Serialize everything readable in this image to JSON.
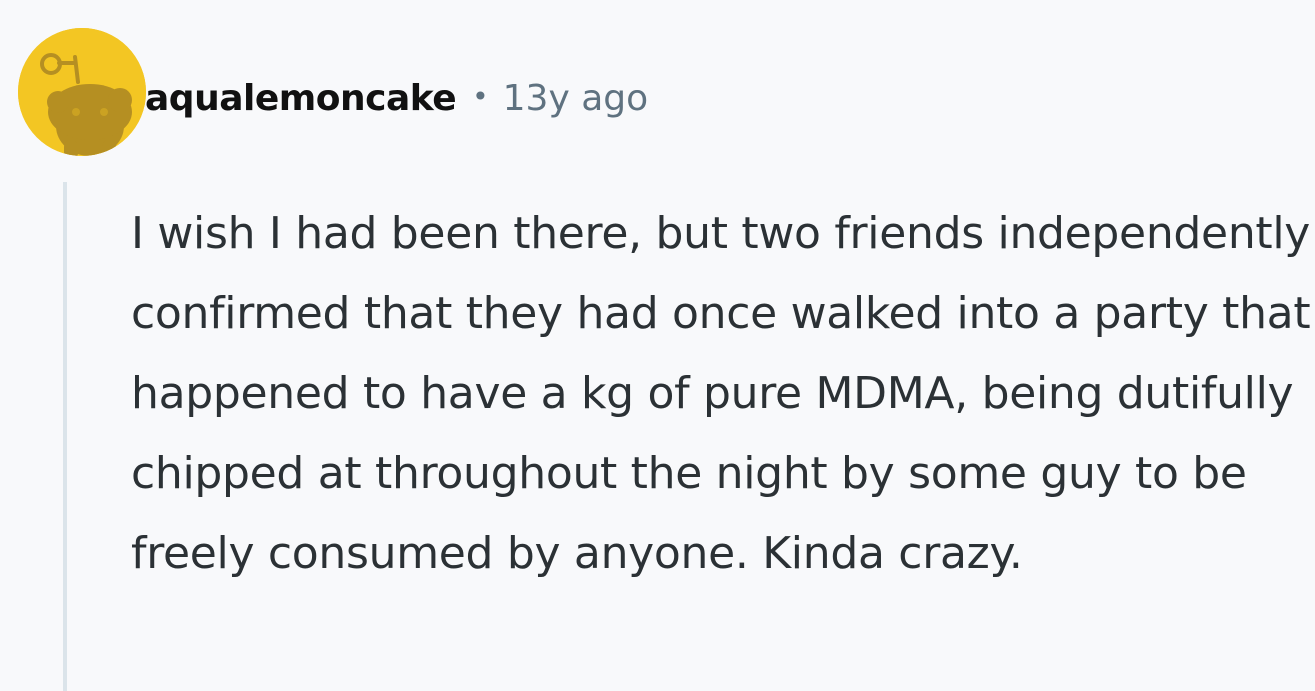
{
  "comment": {
    "username": "aqualemoncake",
    "separator": "•",
    "timestamp": "13y ago",
    "avatar_icon": "reddit-snoo-icon",
    "body": "I wish I had been there, but two friends independently confirmed that they had once walked into a party that happened to have a kg of pure MDMA, being dutifully chipped at throughout the night by some guy to be freely consumed by anyone. Kinda crazy."
  },
  "colors": {
    "background": "#f8f9fb",
    "avatar_background": "#f3c623",
    "avatar_figure": "#b58f22",
    "meta_text": "#5f7280",
    "thread_line": "#dbe4ea",
    "body_text": "#2b3135"
  }
}
